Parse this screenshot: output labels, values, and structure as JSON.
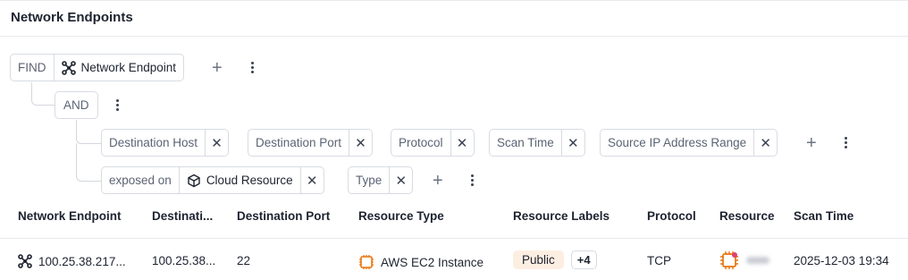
{
  "header": {
    "title": "Network Endpoints"
  },
  "query": {
    "find_label": "FIND",
    "entity": {
      "label": "Network Endpoint",
      "icon": "network-endpoint-icon"
    },
    "and_label": "AND",
    "filters": [
      {
        "label": "Destination Host"
      },
      {
        "label": "Destination Port"
      },
      {
        "label": "Protocol"
      },
      {
        "label": "Scan Time"
      },
      {
        "label": "Source IP Address Range"
      }
    ],
    "relation": {
      "label": "exposed on",
      "entity": {
        "label": "Cloud Resource",
        "icon": "cube-icon"
      },
      "filters": [
        {
          "label": "Type"
        }
      ]
    },
    "add_symbol": "+",
    "close_symbol": "✕"
  },
  "table": {
    "columns": [
      "Network Endpoint",
      "Destinati...",
      "Destination Port",
      "Resource Type",
      "Resource Labels",
      "Protocol",
      "Resource",
      "Scan Time"
    ],
    "rows": [
      {
        "endpoint": "100.25.38.217...",
        "destination": "100.25.38...",
        "port": "22",
        "resource_type": "AWS EC2 Instance",
        "label": "Public",
        "more_labels": "+4",
        "protocol": "TCP",
        "scan_time": "2025-12-03 19:34"
      }
    ]
  },
  "colors": {
    "accent_orange": "#e8740c",
    "badge_bg": "#fdeee2",
    "border": "#d7dbe2"
  }
}
